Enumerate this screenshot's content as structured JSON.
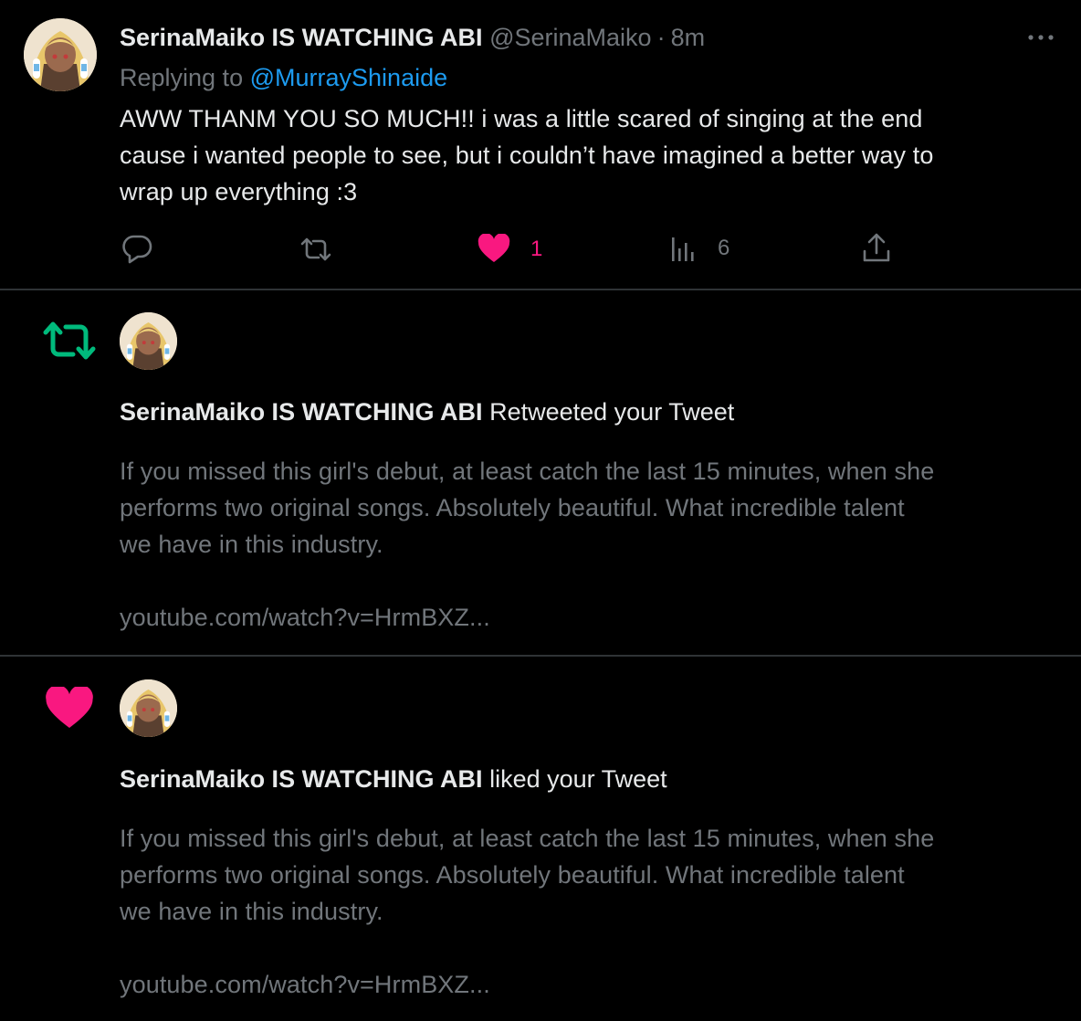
{
  "reply_tweet": {
    "display_name": "SerinaMaiko IS WATCHING ABI",
    "handle": "@SerinaMaiko",
    "separator": "·",
    "time": "8m",
    "replying_prefix": "Replying to",
    "replying_handle": "@MurrayShinaide",
    "body_lines": [
      "AWW THANM YOU SO MUCH!! i was a little scared of singing at the end",
      "cause i wanted people to see, but i couldn’t have imagined a better way to",
      "wrap up everything :3"
    ],
    "actions": {
      "reply_icon": "reply-icon",
      "retweet_icon": "retweet-icon",
      "like_icon": "heart-filled-icon",
      "like_count": "1",
      "views_icon": "analytics-icon",
      "views_count": "6",
      "share_icon": "share-icon"
    },
    "more_icon": "more-icon"
  },
  "notifications": [
    {
      "type": "retweet",
      "icon": "retweet-icon",
      "icon_color": "#00ba7c",
      "actor_name": "SerinaMaiko IS WATCHING ABI",
      "action_text": "Retweeted your Tweet",
      "preview_lines": [
        "If you missed this girl's debut, at least catch the last 15 minutes, when she",
        "performs two original songs. Absolutely beautiful. What incredible talent",
        "we have in this industry."
      ],
      "link": "youtube.com/watch?v=HrmBXZ..."
    },
    {
      "type": "like",
      "icon": "heart-filled-icon",
      "icon_color": "#f91880",
      "actor_name": "SerinaMaiko IS WATCHING ABI",
      "action_text": "liked your Tweet",
      "preview_lines": [
        "If you missed this girl's debut, at least catch the last 15 minutes, when she",
        "performs two original songs. Absolutely beautiful. What incredible talent",
        "we have in this industry."
      ],
      "link": "youtube.com/watch?v=HrmBXZ..."
    }
  ],
  "colors": {
    "background": "#000000",
    "text": "#e7e9ea",
    "muted": "#71767b",
    "accent": "#1d9bf0",
    "like": "#f91880",
    "retweet": "#00ba7c",
    "divider": "#2f3336"
  }
}
